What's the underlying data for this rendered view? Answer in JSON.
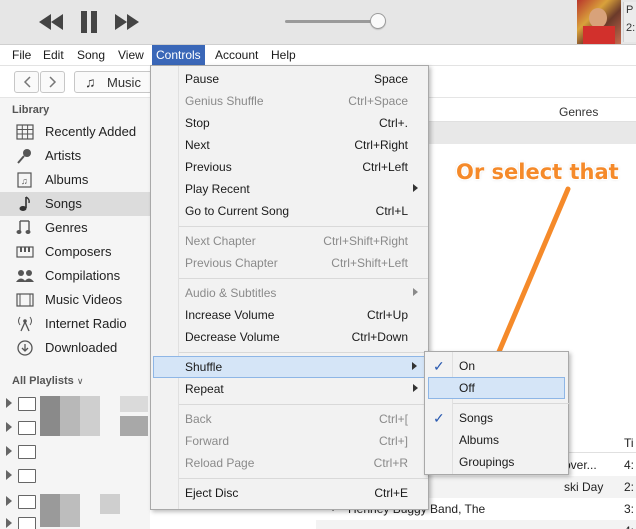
{
  "player": {
    "now_playing_text_1": "P",
    "now_playing_text_2": "2:"
  },
  "menubar": {
    "items": [
      "File",
      "Edit",
      "Song",
      "View",
      "Controls",
      "Account",
      "Help"
    ],
    "active": "Controls"
  },
  "nav": {
    "media_label": "Music"
  },
  "sidebar": {
    "library_header": "Library",
    "items": [
      {
        "label": "Recently Added",
        "icon": "grid-icon"
      },
      {
        "label": "Artists",
        "icon": "microphone-icon"
      },
      {
        "label": "Albums",
        "icon": "album-icon"
      },
      {
        "label": "Songs",
        "icon": "music-note-icon",
        "selected": true
      },
      {
        "label": "Genres",
        "icon": "genres-icon"
      },
      {
        "label": "Composers",
        "icon": "piano-icon"
      },
      {
        "label": "Compilations",
        "icon": "people-icon"
      },
      {
        "label": "Music Videos",
        "icon": "video-icon"
      },
      {
        "label": "Internet Radio",
        "icon": "antenna-icon"
      },
      {
        "label": "Downloaded",
        "icon": "download-icon"
      }
    ],
    "playlists_header": "All Playlists"
  },
  "main": {
    "genres_header": "Genres",
    "rows": [
      {
        "text": "over..."
      },
      {
        "text": "ski Day"
      },
      {
        "text": "Henney Buggy Band, The"
      },
      {
        "text": ""
      }
    ],
    "right_col_head": "Ti",
    "times": [
      "4:",
      "2:",
      "3:",
      "4:"
    ]
  },
  "annotation": "Or select that",
  "controls_menu": {
    "groups": [
      [
        {
          "label": "Pause",
          "shortcut": "Space"
        },
        {
          "label": "Genius Shuffle",
          "shortcut": "Ctrl+Space",
          "disabled": true
        },
        {
          "label": "Stop",
          "shortcut": "Ctrl+."
        },
        {
          "label": "Next",
          "shortcut": "Ctrl+Right"
        },
        {
          "label": "Previous",
          "shortcut": "Ctrl+Left"
        },
        {
          "label": "Play Recent",
          "shortcut": "",
          "submenu": true
        },
        {
          "label": "Go to Current Song",
          "shortcut": "Ctrl+L"
        }
      ],
      [
        {
          "label": "Next Chapter",
          "shortcut": "Ctrl+Shift+Right",
          "disabled": true
        },
        {
          "label": "Previous Chapter",
          "shortcut": "Ctrl+Shift+Left",
          "disabled": true
        }
      ],
      [
        {
          "label": "Audio & Subtitles",
          "shortcut": "",
          "disabled": true,
          "submenu": true
        },
        {
          "label": "Increase Volume",
          "shortcut": "Ctrl+Up"
        },
        {
          "label": "Decrease Volume",
          "shortcut": "Ctrl+Down"
        }
      ],
      [
        {
          "label": "Shuffle",
          "shortcut": "",
          "submenu": true,
          "highlighted": true
        },
        {
          "label": "Repeat",
          "shortcut": "",
          "submenu": true
        }
      ],
      [
        {
          "label": "Back",
          "shortcut": "Ctrl+[",
          "disabled": true
        },
        {
          "label": "Forward",
          "shortcut": "Ctrl+]",
          "disabled": true
        },
        {
          "label": "Reload Page",
          "shortcut": "Ctrl+R",
          "disabled": true
        }
      ],
      [
        {
          "label": "Eject Disc",
          "shortcut": "Ctrl+E"
        }
      ]
    ]
  },
  "shuffle_submenu": {
    "items": [
      {
        "label": "On",
        "checked": true
      },
      {
        "label": "Off",
        "highlighted": true
      },
      {
        "label": "Songs",
        "checked": true
      },
      {
        "label": "Albums"
      },
      {
        "label": "Groupings"
      }
    ]
  },
  "colors": {
    "menu_active": "#3a67b8",
    "highlight_fill": "#d5e5f7",
    "highlight_border": "#8eb6e6",
    "annotation": "#f58a2a",
    "checkmark": "#2a5ab0"
  }
}
